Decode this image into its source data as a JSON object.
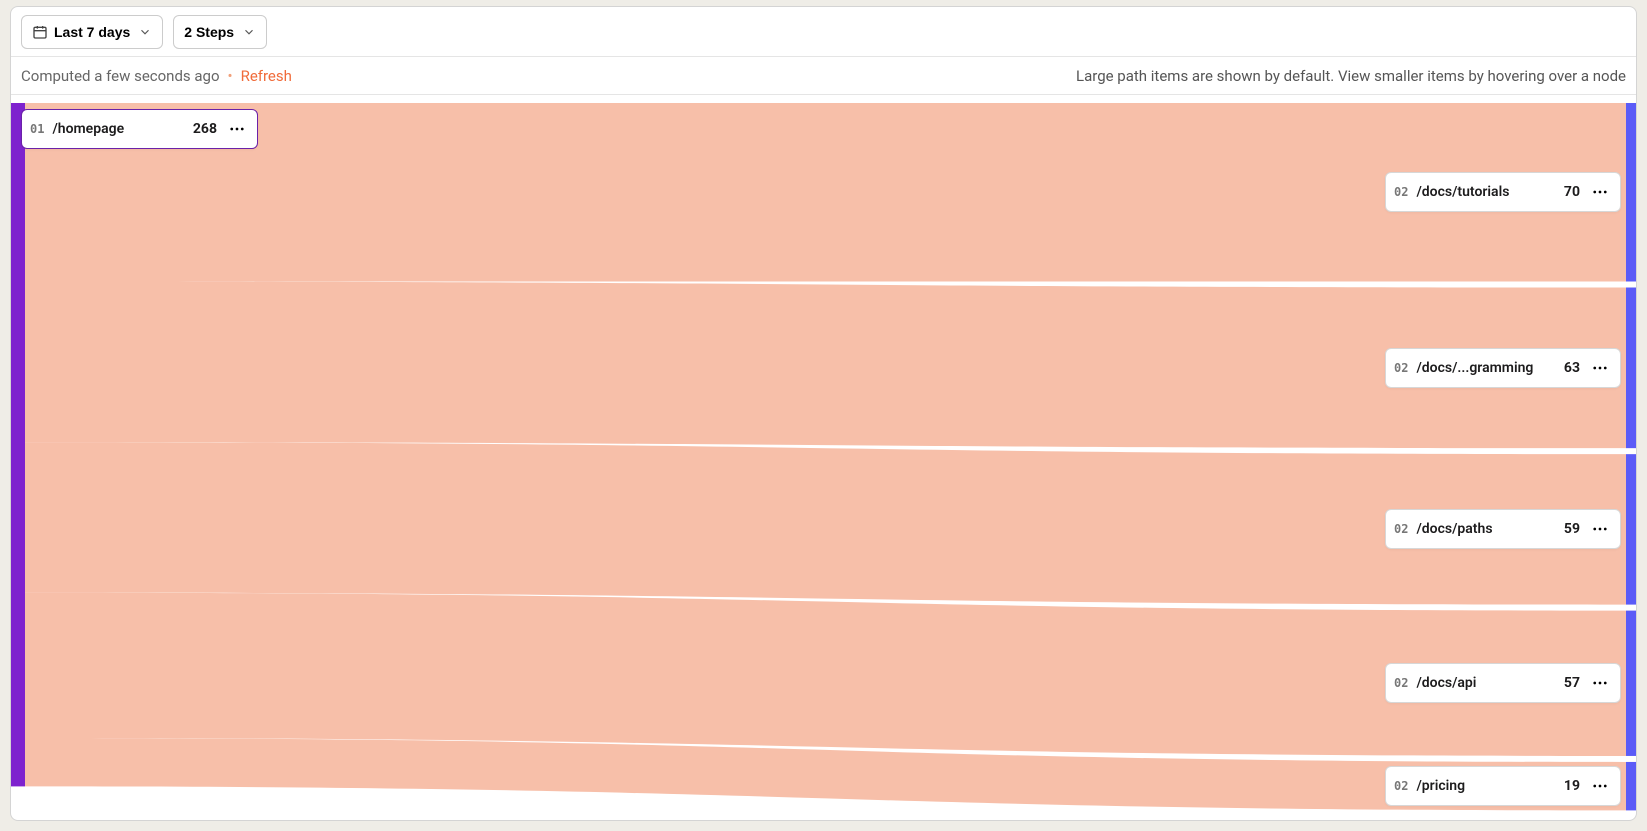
{
  "toolbar": {
    "date_range_label": "Last 7 days",
    "steps_label": "2 Steps"
  },
  "status": {
    "computed_label": "Computed a few seconds ago",
    "refresh_label": "Refresh",
    "help_text": "Large path items are shown by default. View smaller items by hovering over a node"
  },
  "source_node": {
    "step": "01",
    "label": "/homepage",
    "value": "268"
  },
  "target_nodes": [
    {
      "step": "02",
      "label": "/docs/tutorials",
      "value": "70"
    },
    {
      "step": "02",
      "label": "/docs/...gramming",
      "value": "63"
    },
    {
      "step": "02",
      "label": "/docs/paths",
      "value": "59"
    },
    {
      "step": "02",
      "label": "/docs/api",
      "value": "57"
    },
    {
      "step": "02",
      "label": "/pricing",
      "value": "19"
    }
  ],
  "colors": {
    "source_bar": "#7e22ce",
    "flow": "#f7bfa9",
    "target_bar": "#5b5bf7"
  },
  "chart_data": {
    "type": "sankey",
    "title": "",
    "steps": 2,
    "source": {
      "name": "/homepage",
      "value": 268
    },
    "targets": [
      {
        "name": "/docs/tutorials",
        "value": 70
      },
      {
        "name": "/docs/...gramming",
        "value": 63
      },
      {
        "name": "/docs/paths",
        "value": 59
      },
      {
        "name": "/docs/api",
        "value": 57
      },
      {
        "name": "/pricing",
        "value": 19
      }
    ]
  }
}
